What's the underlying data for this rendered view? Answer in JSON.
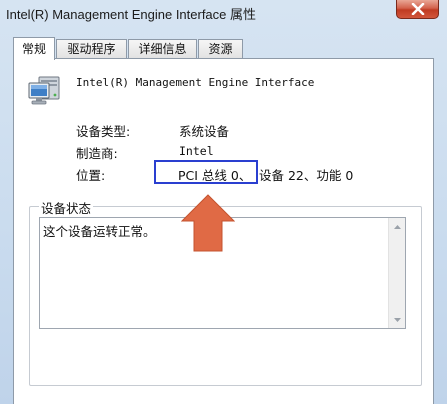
{
  "window": {
    "title": "Intel(R) Management Engine Interface  属性"
  },
  "tabs": [
    {
      "label": "常规",
      "active": true
    },
    {
      "label": "驱动程序",
      "active": false
    },
    {
      "label": "详细信息",
      "active": false
    },
    {
      "label": "资源",
      "active": false
    }
  ],
  "device": {
    "name": "Intel(R) Management Engine Interface",
    "icon": "computer-device-icon"
  },
  "properties": {
    "type_label": "设备类型:",
    "type_value": "系统设备",
    "manufacturer_label": "制造商:",
    "manufacturer_value": "Intel",
    "location_label": "位置:",
    "location_highlighted": "PCI 总线 0、",
    "location_rest": "设备 22、功能 0"
  },
  "status": {
    "legend": "设备状态",
    "text": "这个设备运转正常。"
  },
  "colors": {
    "highlight_box": "#2a3fd0",
    "arrow": "#e06a45"
  },
  "icons": {
    "close": "close-icon",
    "arrow": "up-arrow-icon",
    "scroll_up": "chevron-up-icon",
    "scroll_down": "chevron-down-icon"
  }
}
